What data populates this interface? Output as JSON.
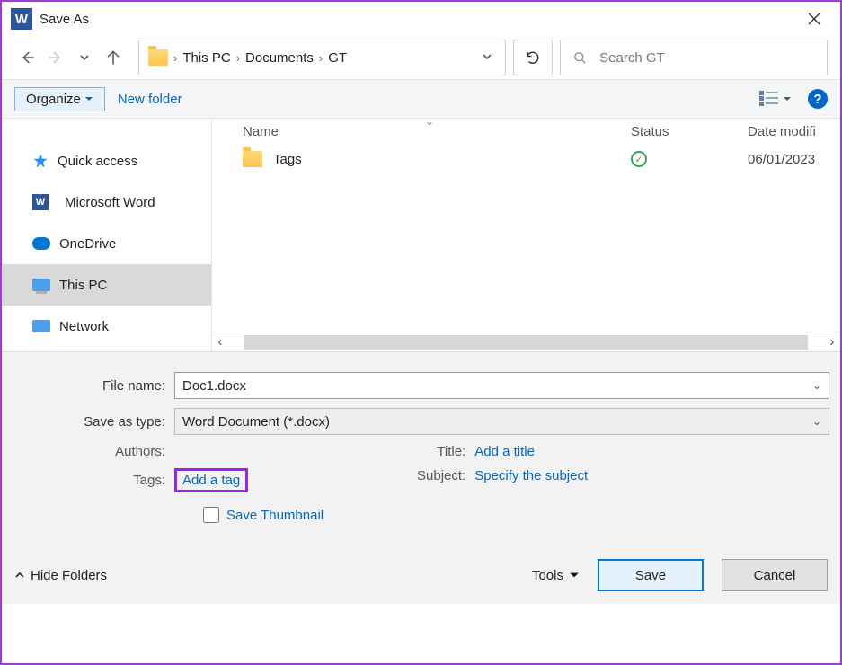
{
  "window": {
    "title": "Save As",
    "app_icon_letter": "W"
  },
  "breadcrumb": {
    "items": [
      "This PC",
      "Documents",
      "GT"
    ]
  },
  "search": {
    "placeholder": "Search GT"
  },
  "toolbar": {
    "organize_label": "Organize",
    "new_folder_label": "New folder",
    "help_glyph": "?"
  },
  "columns": {
    "name": "Name",
    "status": "Status",
    "date": "Date modifi"
  },
  "sidebar": {
    "items": [
      {
        "label": "Quick access"
      },
      {
        "label": "Microsoft Word"
      },
      {
        "label": "OneDrive"
      },
      {
        "label": "This PC"
      },
      {
        "label": "Network"
      }
    ]
  },
  "files": {
    "rows": [
      {
        "name": "Tags",
        "status": "synced",
        "date": "06/01/2023"
      }
    ]
  },
  "form": {
    "file_name_label": "File name:",
    "file_name_value": "Doc1.docx",
    "save_type_label": "Save as type:",
    "save_type_value": "Word Document (*.docx)"
  },
  "meta": {
    "authors_label": "Authors:",
    "authors_value": "",
    "tags_label": "Tags:",
    "tags_value": "Add a tag",
    "title_label": "Title:",
    "title_value": "Add a title",
    "subject_label": "Subject:",
    "subject_value": "Specify the subject",
    "save_thumb_label": "Save Thumbnail"
  },
  "buttons": {
    "hide_folders": "Hide Folders",
    "tools": "Tools",
    "save": "Save",
    "cancel": "Cancel"
  }
}
